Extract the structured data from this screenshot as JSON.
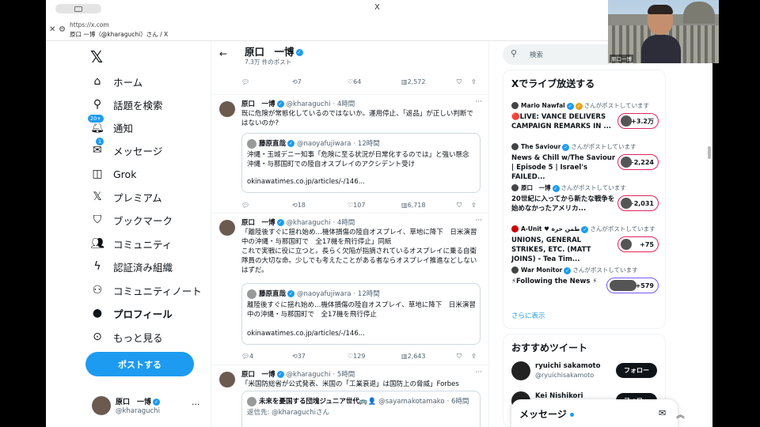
{
  "browser": {
    "close_tab": "X",
    "url": "https://x.com",
    "page_title": "原口 一博（@kharaguchi）さん / X"
  },
  "nav": {
    "items": [
      {
        "label": "ホーム",
        "icon": "home-icon"
      },
      {
        "label": "話題を検索",
        "icon": "search-icon"
      },
      {
        "label": "通知",
        "icon": "bell-icon",
        "badge": "20+"
      },
      {
        "label": "メッセージ",
        "icon": "mail-icon",
        "badge": "1"
      },
      {
        "label": "Grok",
        "icon": "grok-icon"
      },
      {
        "label": "プレミアム",
        "icon": "x-icon"
      },
      {
        "label": "ブックマーク",
        "icon": "bookmark-icon"
      },
      {
        "label": "コミュニティ",
        "icon": "community-icon"
      },
      {
        "label": "認証済み組織",
        "icon": "lightning-icon"
      },
      {
        "label": "コミュニティノート",
        "icon": "notes-icon"
      },
      {
        "label": "プロフィール",
        "icon": "person-icon"
      },
      {
        "label": "もっと見る",
        "icon": "more-circle-icon"
      }
    ],
    "post_button": "ポストする",
    "account": {
      "name": "原口　一博",
      "handle": "@kharaguchi",
      "more": "···"
    }
  },
  "feed": {
    "header": {
      "name": "原口　一博",
      "post_count": "7.3万 件のポスト"
    },
    "top_actions": {
      "retweets": "7",
      "likes": "64",
      "views": "2,572"
    },
    "tweets": [
      {
        "name": "原口　一博",
        "handle": "@kharaguchi",
        "time": "· 4時間",
        "text": "既に危険が常態化しているのではないか。運用停止、「返品」が正しい判断ではないのか?",
        "quote": {
          "name": "藤原直哉",
          "handle": "@naoyafujiwara",
          "time": "· 12時間",
          "text": "沖縄・玉城デニー知事「危険に至る状況が日常化するのでは」と強い懸念　沖縄・与那国町での陸自オスプレイのアクシデント受け",
          "link": "okinawatimes.co.jp/articles/-/146..."
        },
        "actions": {
          "replies": "",
          "retweets": "18",
          "likes": "107",
          "views": "6,718"
        }
      },
      {
        "name": "原口　一博",
        "handle": "@kharaguchi",
        "time": "· 4時間",
        "text": "「離陸後すぐに揺れ始め…機体損傷の陸自オスプレイ、草地に降下　日米演習中の沖縄・与那国町で　全17機を飛行停止」同紙\nこれで実戦に役に立つと。長らく欠陥が指摘されているオスプレイに乗る自衛隊員の大切な命。少しでも考えたことがある者ならオスプレイ推進などしないはずだ。",
        "quote": {
          "name": "藤原直哉",
          "handle": "@naoyafujiwara",
          "time": "· 12時間",
          "text": "離陸後すぐに揺れ始め…機体損傷の陸自オスプレイ、草地に降下　日米演習中の沖縄・与那国町で　全17機を飛行停止",
          "link": "okinawatimes.co.jp/articles/-/146..."
        },
        "actions": {
          "replies": "4",
          "retweets": "37",
          "likes": "129",
          "views": "2,643"
        }
      },
      {
        "name": "原口　一博",
        "handle": "@kharaguchi",
        "time": "· 5時間",
        "text": "「米国防総省が公式発表、米国の「工業衰退」は国防上の脅威」Forbes",
        "quote": {
          "name": "未来を憂国する団塊ジュニア世代🚌👤",
          "handle": "@sayamakotamako",
          "time": "· 6時間",
          "text": "返信先: @kharaguchiさん"
        }
      }
    ]
  },
  "right": {
    "search_placeholder": "検索",
    "live": {
      "title": "Xでライブ放送する",
      "items": [
        {
          "name": "Mario Nawfal",
          "suffix": "さんがポストしています",
          "title": "🔴LIVE: VANCE DELIVERS CAMPAIGN REMARKS IN ...",
          "count": "+3.2万"
        },
        {
          "name": "The Saviour",
          "suffix": "さんがポストしています",
          "title": "News & Chill w/The Saviour | Episode 5 | Israel's FAILED...",
          "count": "+2,224"
        },
        {
          "name": "原口　一博",
          "suffix": "さんがポストしています",
          "title": "20世紀に入ってから新たな戦争を始めなかったアメリカ...",
          "count": "+2,031"
        },
        {
          "name": "A-Unit ♥ طمن حرة",
          "suffix": "さんがポストしています",
          "title": "UNIONS, GENERAL STRIKES, ETC. (MATT JOINS) - Tea Tim...",
          "count": "+75"
        },
        {
          "name": "War Monitor",
          "suffix": "さんがポストしています",
          "title": "⚡Following the News ⚡",
          "count": "+579"
        }
      ],
      "more": "さらに表示"
    },
    "recommended": {
      "title": "おすすめツイート",
      "items": [
        {
          "name": "ryuichi sakamoto",
          "handle": "@ryuichisakamoto",
          "follow": "フォロー"
        },
        {
          "name": "Kei Nishikori",
          "handle": "",
          "follow": "フォロー"
        }
      ]
    },
    "messages": {
      "title": "メッセージ"
    }
  },
  "webcam": {
    "label": "原口一博"
  }
}
